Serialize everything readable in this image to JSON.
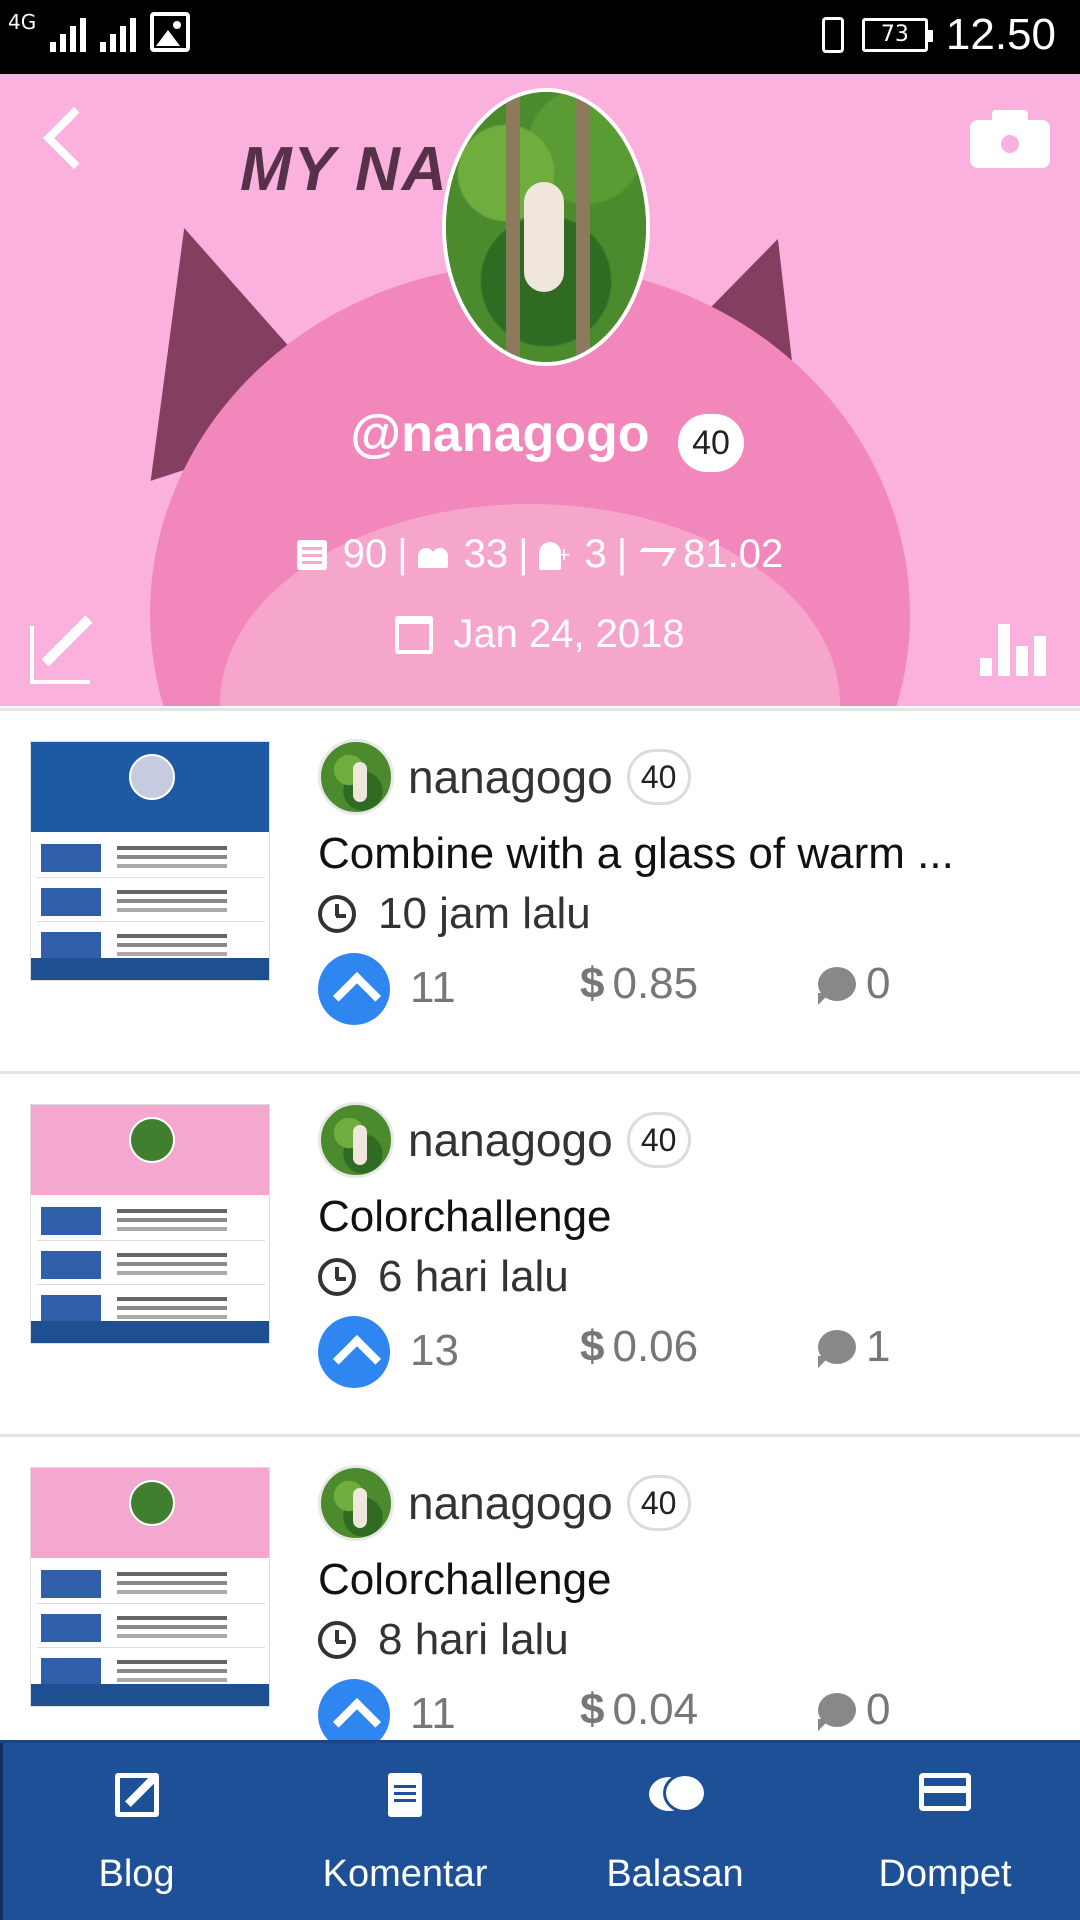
{
  "status_bar": {
    "network": "4G",
    "battery": "73",
    "time": "12.50"
  },
  "profile": {
    "cover_text": "MY NA...S...",
    "username": "@nanagogo",
    "reputation": "40",
    "stats": {
      "posts": "90",
      "followers": "33",
      "following": "3",
      "power": "81.02"
    },
    "joined": "Jan 24, 2018"
  },
  "posts": [
    {
      "author": "nanagogo",
      "reputation": "40",
      "title": "Combine with a glass of warm ...",
      "time": "10 jam lalu",
      "votes": "11",
      "payout": "0.85",
      "comments": "0",
      "thumbnail_style": "blue"
    },
    {
      "author": "nanagogo",
      "reputation": "40",
      "title": "Colorchallenge",
      "time": "6 hari lalu",
      "votes": "13",
      "payout": "0.06",
      "comments": "1",
      "thumbnail_style": "pink"
    },
    {
      "author": "nanagogo",
      "reputation": "40",
      "title": "Colorchallenge",
      "time": "8 hari lalu",
      "votes": "11",
      "payout": "0.04",
      "comments": "0",
      "thumbnail_style": "pink"
    }
  ],
  "currency_symbol": "$",
  "bottom_nav": [
    {
      "label": "Blog",
      "icon": "edit-icon"
    },
    {
      "label": "Komentar",
      "icon": "document-icon"
    },
    {
      "label": "Balasan",
      "icon": "chat-icon"
    },
    {
      "label": "Dompet",
      "icon": "wallet-icon"
    }
  ],
  "colors": {
    "header_bg": "#f9b1dd",
    "nav_bg": "#1d5096",
    "upvote": "#2f86f0"
  }
}
